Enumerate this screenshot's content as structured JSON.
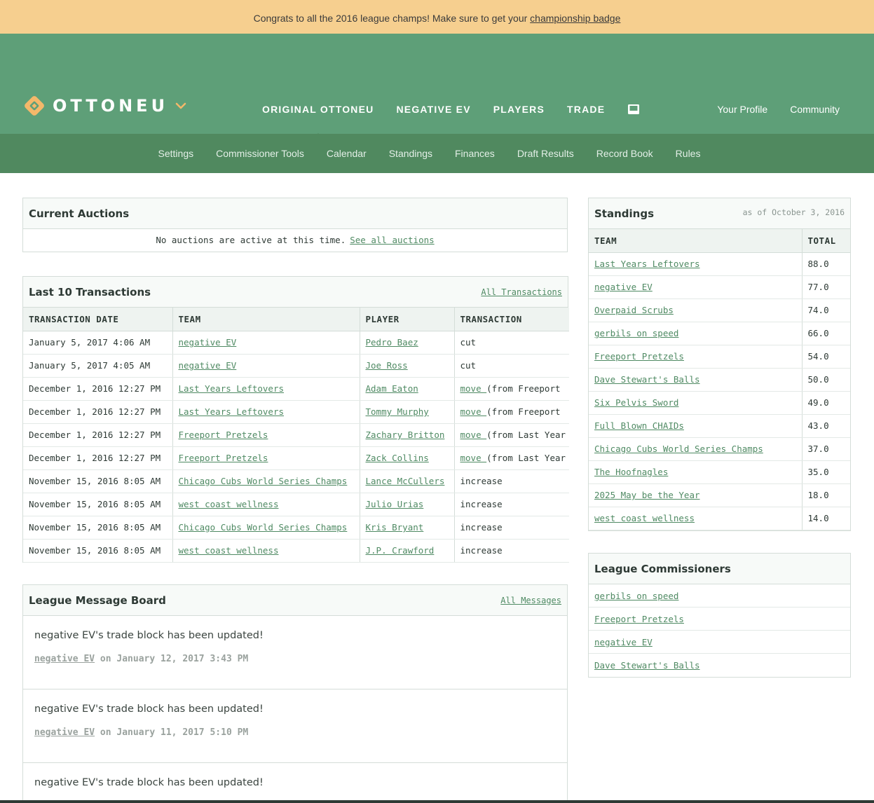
{
  "banner": {
    "text": "Congrats to all the 2016 league champs! Make sure to get your",
    "link": "championship badge"
  },
  "brand": {
    "name": "OTTONEU"
  },
  "main_nav": [
    "ORIGINAL OTTONEU",
    "NEGATIVE EV",
    "PLAYERS",
    "TRADE"
  ],
  "right_nav": [
    "Your Profile",
    "Community"
  ],
  "sub_nav": [
    "Settings",
    "Commissioner Tools",
    "Calendar",
    "Standings",
    "Finances",
    "Draft Results",
    "Record Book",
    "Rules"
  ],
  "auctions": {
    "title": "Current Auctions",
    "empty_text": "No auctions are active at this time.",
    "link": "See all auctions"
  },
  "transactions": {
    "title": "Last 10 Transactions",
    "link": "All Transactions",
    "columns": [
      "TRANSACTION DATE",
      "TEAM",
      "PLAYER",
      "TRANSACTION"
    ],
    "rows": [
      {
        "date": "January 5, 2017 4:06 AM",
        "team": "negative EV",
        "player": "Pedro Baez",
        "action": "cut",
        "detail": ""
      },
      {
        "date": "January 5, 2017 4:05 AM",
        "team": "negative EV",
        "player": "Joe Ross",
        "action": "cut",
        "detail": ""
      },
      {
        "date": "December 1, 2016 12:27 PM",
        "team": "Last Years Leftovers",
        "player": "Adam Eaton",
        "action": "move ",
        "detail": "(from Freeport"
      },
      {
        "date": "December 1, 2016 12:27 PM",
        "team": "Last Years Leftovers",
        "player": "Tommy Murphy",
        "action": "move ",
        "detail": "(from Freeport"
      },
      {
        "date": "December 1, 2016 12:27 PM",
        "team": "Freeport Pretzels",
        "player": "Zachary Britton",
        "action": "move ",
        "detail": "(from Last Year"
      },
      {
        "date": "December 1, 2016 12:27 PM",
        "team": "Freeport Pretzels",
        "player": "Zack Collins",
        "action": "move ",
        "detail": "(from Last Year"
      },
      {
        "date": "November 15, 2016 8:05 AM",
        "team": "Chicago Cubs World Series Champs",
        "player": "Lance McCullers",
        "action": "increase",
        "detail": ""
      },
      {
        "date": "November 15, 2016 8:05 AM",
        "team": "west coast wellness",
        "player": "Julio Urias",
        "action": "increase",
        "detail": ""
      },
      {
        "date": "November 15, 2016 8:05 AM",
        "team": "Chicago Cubs World Series Champs",
        "player": "Kris Bryant",
        "action": "increase",
        "detail": ""
      },
      {
        "date": "November 15, 2016 8:05 AM",
        "team": "west coast wellness",
        "player": "J.P. Crawford",
        "action": "increase",
        "detail": ""
      }
    ]
  },
  "messages": {
    "title": "League Message Board",
    "link": "All Messages",
    "items": [
      {
        "text": "negative EV's trade block has been updated!",
        "author": "negative EV",
        "on": "on",
        "date": "January 12, 2017 3:43 PM"
      },
      {
        "text": "negative EV's trade block has been updated!",
        "author": "negative EV",
        "on": "on",
        "date": "January 11, 2017 5:10 PM"
      },
      {
        "text": "negative EV's trade block has been updated!",
        "author": "",
        "on": "",
        "date": ""
      }
    ]
  },
  "standings": {
    "title": "Standings",
    "as_of": "as of October 3, 2016",
    "columns": [
      "TEAM",
      "TOTAL"
    ],
    "rows": [
      {
        "team": "Last Years Leftovers",
        "total": "88.0"
      },
      {
        "team": "negative EV",
        "total": "77.0"
      },
      {
        "team": "Overpaid Scrubs",
        "total": "74.0"
      },
      {
        "team": "gerbils on speed",
        "total": "66.0"
      },
      {
        "team": "Freeport Pretzels",
        "total": "54.0"
      },
      {
        "team": "Dave Stewart's Balls",
        "total": "50.0"
      },
      {
        "team": "Six Pelvis Sword",
        "total": "49.0"
      },
      {
        "team": "Full Blown CHAIDs",
        "total": "43.0"
      },
      {
        "team": "Chicago Cubs World Series Champs",
        "total": "37.0"
      },
      {
        "team": "The Hoofnagles",
        "total": "35.0"
      },
      {
        "team": "2025 May be the Year",
        "total": "18.0"
      },
      {
        "team": "west coast wellness",
        "total": "14.0"
      }
    ]
  },
  "commissioners": {
    "title": "League Commissioners",
    "items": [
      "gerbils on speed",
      "Freeport Pretzels",
      "negative EV",
      "Dave Stewart's Balls"
    ]
  },
  "colors": {
    "banner": "#f6cf8f",
    "header": "#5e9f78",
    "subnav": "#50895f",
    "link": "#4f8a63",
    "logo": "#f4b86a"
  }
}
